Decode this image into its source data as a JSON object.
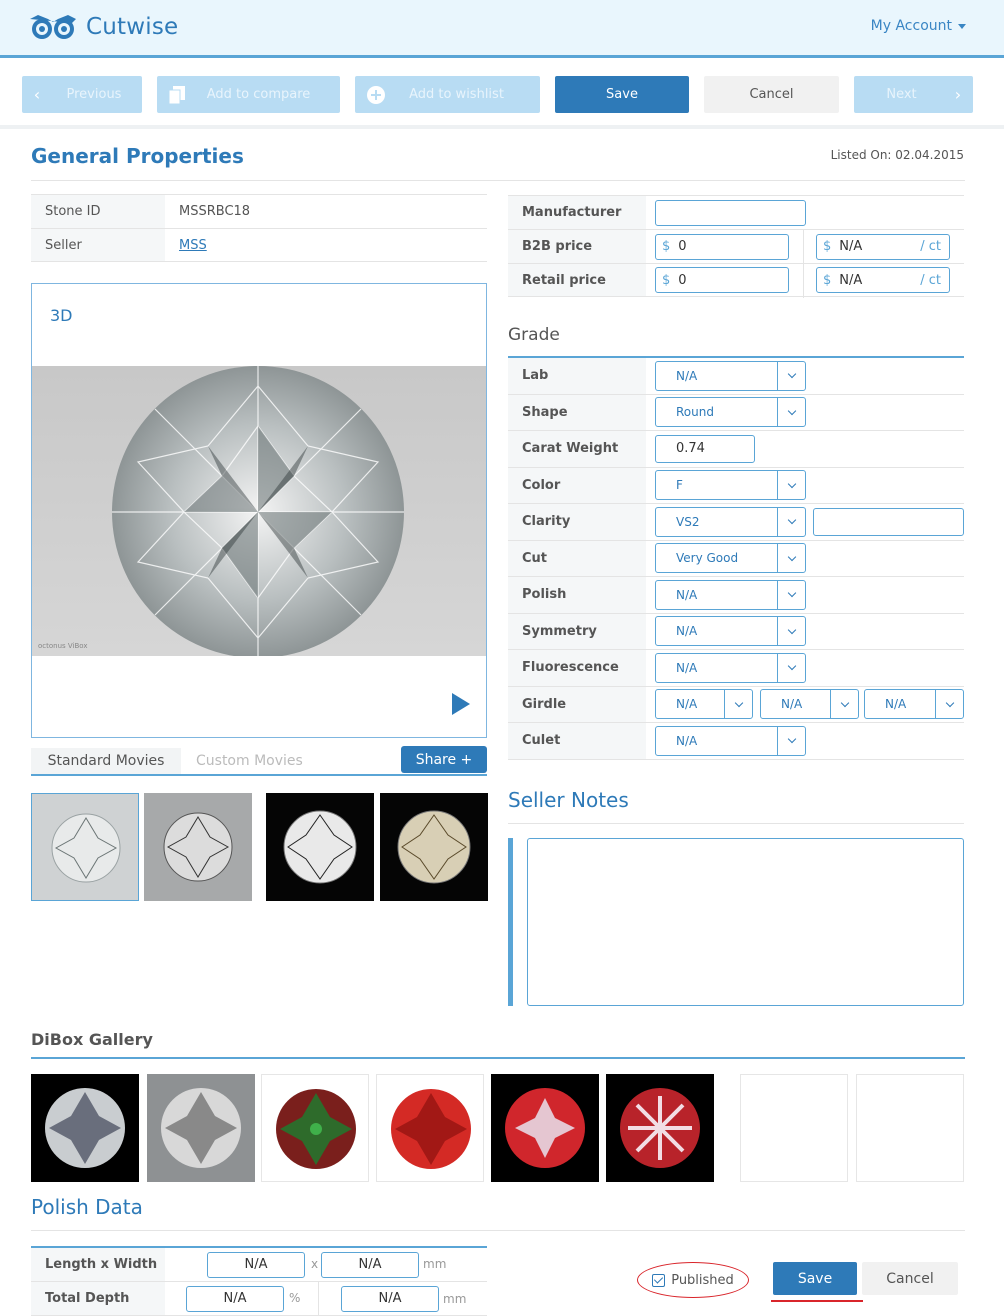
{
  "header": {
    "brand": "Cutwise",
    "account_label": "My Account"
  },
  "toolbar": {
    "previous": "Previous",
    "add_compare": "Add to compare",
    "add_wishlist": "Add to wishlist",
    "save": "Save",
    "cancel": "Cancel",
    "next": "Next"
  },
  "general": {
    "title": "General Properties",
    "listed_on": "Listed On: 02.04.2015",
    "stone_id_label": "Stone ID",
    "stone_id": "MSSRBC18",
    "seller_label": "Seller",
    "seller": "MSS",
    "manufacturer_label": "Manufacturer",
    "manufacturer_value": "",
    "b2b_label": "B2B price",
    "b2b_value": "0",
    "b2b_per_ct": "N/A",
    "retail_label": "Retail price",
    "retail_value": "0",
    "retail_per_ct": "N/A",
    "currency": "$",
    "per_ct_unit": "/ ct"
  },
  "viewer": {
    "label": "3D",
    "watermark": "octonus ViBox"
  },
  "movies": {
    "tab_standard": "Standard Movies",
    "tab_custom": "Custom Movies",
    "share": "Share +"
  },
  "grade": {
    "title": "Grade",
    "rows": [
      {
        "label": "Lab",
        "value": "N/A"
      },
      {
        "label": "Shape",
        "value": "Round"
      },
      {
        "label": "Carat Weight",
        "value": "0.74"
      },
      {
        "label": "Color",
        "value": "F"
      },
      {
        "label": "Clarity",
        "value": "VS2"
      },
      {
        "label": "Cut",
        "value": "Very Good"
      },
      {
        "label": "Polish",
        "value": "N/A"
      },
      {
        "label": "Symmetry",
        "value": "N/A"
      },
      {
        "label": "Fluorescence",
        "value": "N/A"
      },
      {
        "label": "Girdle",
        "value": "N/A",
        "value2": "N/A",
        "value3": "N/A"
      },
      {
        "label": "Culet",
        "value": "N/A"
      }
    ]
  },
  "seller_notes": {
    "title": "Seller Notes",
    "value": ""
  },
  "dibox": {
    "title": "DiBox Gallery"
  },
  "polish": {
    "title": "Polish Data",
    "lw_label": "Length x Width",
    "length": "N/A",
    "x": "x",
    "width": "N/A",
    "mm": "mm",
    "depth_label": "Total Depth",
    "depth_pct": "N/A",
    "pct": "%",
    "depth_mm": "N/A"
  },
  "footer": {
    "published": "Published",
    "save": "Save",
    "cancel": "Cancel"
  },
  "colors": {
    "accent": "#2e7ab8",
    "accent_light": "#b8dcf3",
    "highlight": "#d9252b"
  }
}
